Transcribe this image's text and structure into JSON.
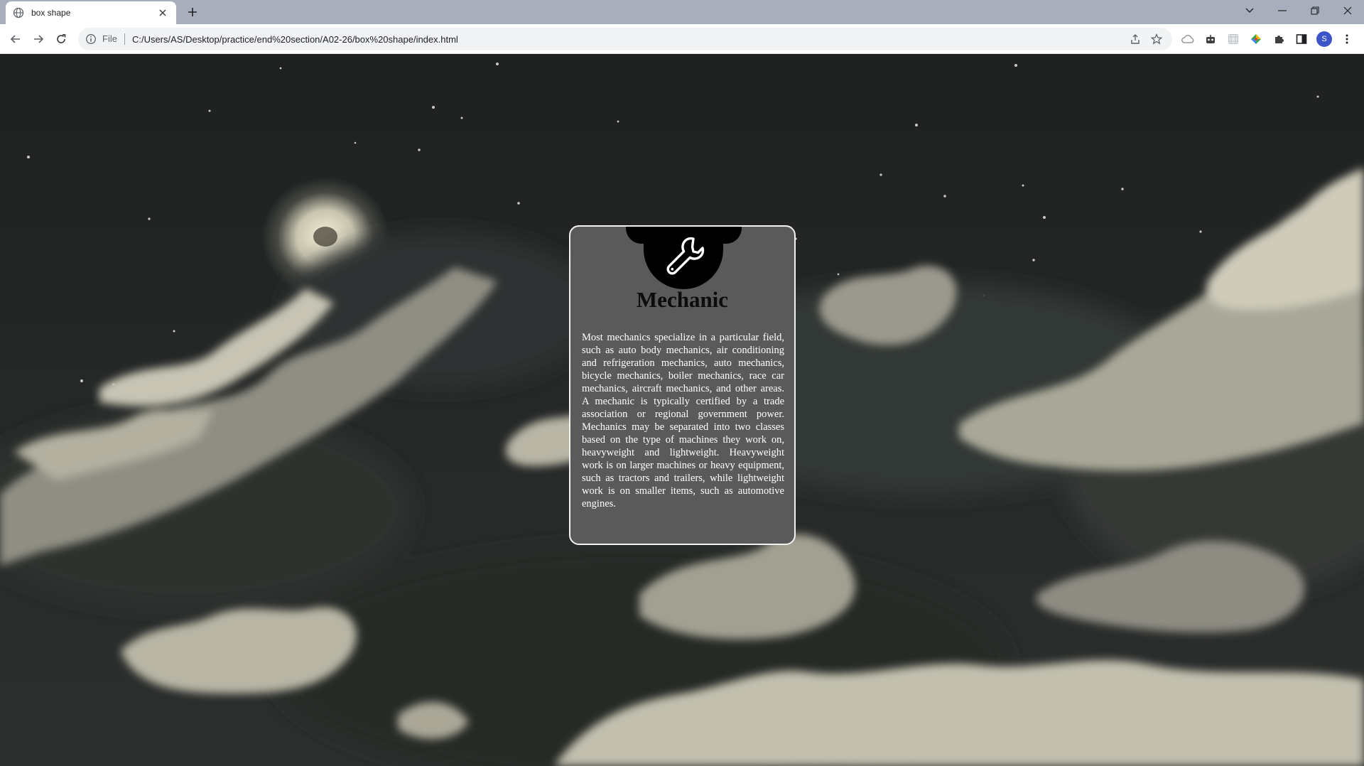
{
  "browser": {
    "tab_title": "box shape",
    "omnibox_chip": "File",
    "url": "C:/Users/AS/Desktop/practice/end%20section/A02-26/box%20shape/index.html",
    "profile_initial": "S"
  },
  "card": {
    "title": "Mechanic",
    "body": "Most mechanics specialize in a particular field, such as auto body mechanics, air conditioning and refrigeration mechanics, auto mechanics, bicycle mechanics, boiler mechanics, race car mechanics, aircraft mechanics, and other areas. A mechanic is typically certified by a trade association or regional government power. Mechanics may be separated into two classes based on the type of machines they work on, heavyweight and lightweight. Heavyweight work is on larger machines or heavy equipment, such as tractors and trailers, while lightweight work is on smaller items, such as automotive engines.",
    "icon": "wrench-icon"
  },
  "colors": {
    "tabstrip": "#a8aebc",
    "card_bg": "#5a5a5a",
    "card_border": "#f2f2f2",
    "badge": "#000000"
  }
}
